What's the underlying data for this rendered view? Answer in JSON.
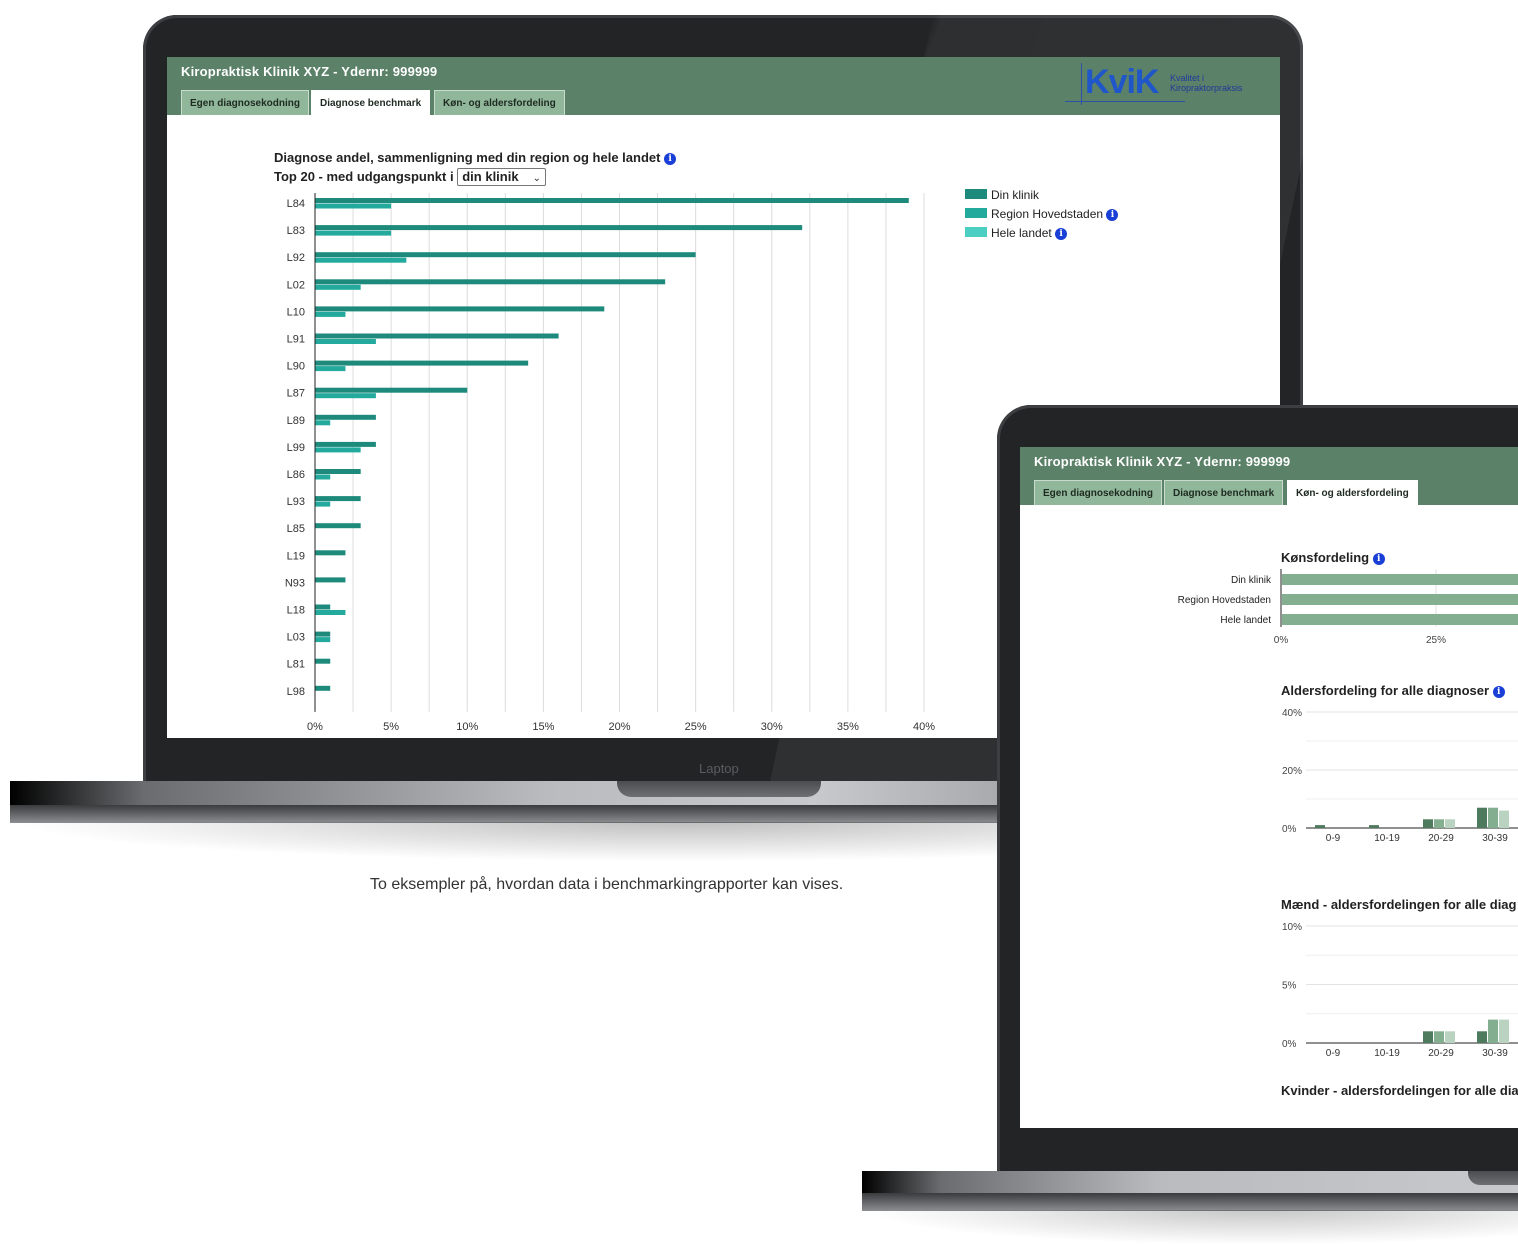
{
  "caption": "To eksempler på, hvordan data i benchmarkingrapporter kan vises.",
  "laptop_label": "Laptop",
  "colors": {
    "header": "#5b8168",
    "din_klinik": "#1d8a7c",
    "region": "#23aa9c",
    "hele": "#4ccfc3",
    "green1": "#4e7b5e",
    "green2": "#84ae90",
    "green3": "#b9d3c0",
    "info": "#1a3fd6"
  },
  "app": {
    "title": "Kiropraktisk Klinik XYZ - Ydernr: 999999",
    "tabs": [
      "Egen diagnosekodning",
      "Diagnose benchmark",
      "Køn- og aldersfordeling"
    ],
    "logo": {
      "name": "KviK",
      "subtitle_line1": "Kvalitet i",
      "subtitle_line2": "Kiropraktorpraksis"
    }
  },
  "screen1": {
    "active_tab": "Diagnose benchmark",
    "chart_title": "Diagnose andel, sammenligning med din region og hele landet",
    "chart_subtitle": "Top 20 - med udgangspunkt i",
    "select_value": "din klinik",
    "legend": [
      "Din klinik",
      "Region Hovedstaden",
      "Hele landet"
    ],
    "info_icon": "i"
  },
  "screen2": {
    "active_tab": "Køn- og aldersfordeling",
    "kon_title": "Kønsfordeling",
    "kon_rows": [
      "Din klinik",
      "Region Hovedstaden",
      "Hele landet"
    ],
    "alder_title": "Aldersfordeling for alle diagnoser",
    "maend_title": "Mænd - aldersfordelingen for alle diag",
    "kvinder_title": "Kvinder - aldersfordelingen for alle dia"
  },
  "chart_data": [
    {
      "type": "bar",
      "orientation": "horizontal",
      "title": "Diagnose andel, sammenligning med din region og hele landet",
      "categories": [
        "L84",
        "L83",
        "L92",
        "L02",
        "L10",
        "L91",
        "L90",
        "L87",
        "L89",
        "L99",
        "L86",
        "L93",
        "L85",
        "L19",
        "N93",
        "L18",
        "L03",
        "L81",
        "L98"
      ],
      "series": [
        {
          "name": "Din klinik",
          "values": [
            39,
            32,
            25,
            23,
            19,
            16,
            14,
            10,
            4,
            4,
            3,
            3,
            3,
            2,
            2,
            1,
            1,
            1,
            1
          ]
        },
        {
          "name": "Region Hovedstaden",
          "values": [
            5,
            5,
            6,
            3,
            2,
            4,
            2,
            4,
            1,
            3,
            1,
            1,
            0,
            0,
            0,
            2,
            1,
            0,
            0
          ]
        }
      ],
      "xticks": [
        "0%",
        "5%",
        "10%",
        "15%",
        "20%",
        "25%",
        "30%",
        "35%",
        "40%"
      ],
      "xlim": [
        0,
        40
      ],
      "grid": true,
      "legend": "right"
    },
    {
      "type": "bar",
      "orientation": "horizontal",
      "title": "Kønsfordeling",
      "categories": [
        "Din klinik",
        "Region Hovedstaden",
        "Hele landet"
      ],
      "xticks": [
        "0%",
        "25%"
      ]
    },
    {
      "type": "bar",
      "title": "Aldersfordeling for alle diagnoser",
      "categories": [
        "0-9",
        "10-19",
        "20-29",
        "30-39"
      ],
      "series": [
        {
          "values": [
            1,
            1,
            3,
            7
          ]
        },
        {
          "values": [
            0,
            0,
            3,
            7
          ]
        },
        {
          "values": [
            0,
            0,
            3,
            6
          ]
        }
      ],
      "yticks": [
        "40%",
        "20%",
        "0%"
      ],
      "ylim": [
        0,
        40
      ]
    },
    {
      "type": "bar",
      "title": "Mænd - aldersfordelingen for alle diag",
      "categories": [
        "0-9",
        "10-19",
        "20-29",
        "30-39"
      ],
      "series": [
        {
          "values": [
            0,
            0,
            1,
            1
          ]
        },
        {
          "values": [
            0,
            0,
            1,
            2
          ]
        },
        {
          "values": [
            0,
            0,
            1,
            2
          ]
        }
      ],
      "yticks": [
        "10%",
        "5%",
        "0%"
      ],
      "ylim": [
        0,
        10
      ]
    }
  ]
}
